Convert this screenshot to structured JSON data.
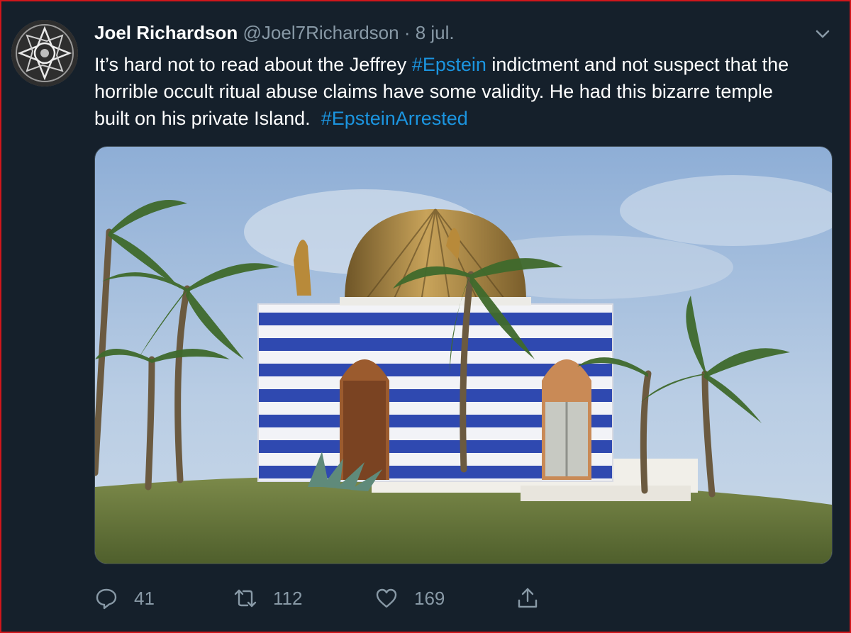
{
  "tweet": {
    "author_name": "Joel Richardson",
    "handle": "@Joel7Richardson",
    "separator": "·",
    "date": "8 jul.",
    "text_part1": "It’s hard not to read about the Jeffrey ",
    "hashtag1": "#Epstein",
    "text_part2": " indictment and not suspect that the horrible occult ritual abuse claims have some validity. He had this bizarre temple built on his private Island.  ",
    "hashtag2": "#EpsteinArrested"
  },
  "actions": {
    "replies": "41",
    "retweets": "112",
    "likes": "169"
  },
  "icons": {
    "reply": "reply-icon",
    "retweet": "retweet-icon",
    "like": "heart-icon",
    "share": "share-icon",
    "menu": "chevron-down-icon"
  },
  "colors": {
    "background": "#15202b",
    "link": "#1b95e0",
    "secondary_text": "#8899a6",
    "frame_border": "#d0161b"
  }
}
